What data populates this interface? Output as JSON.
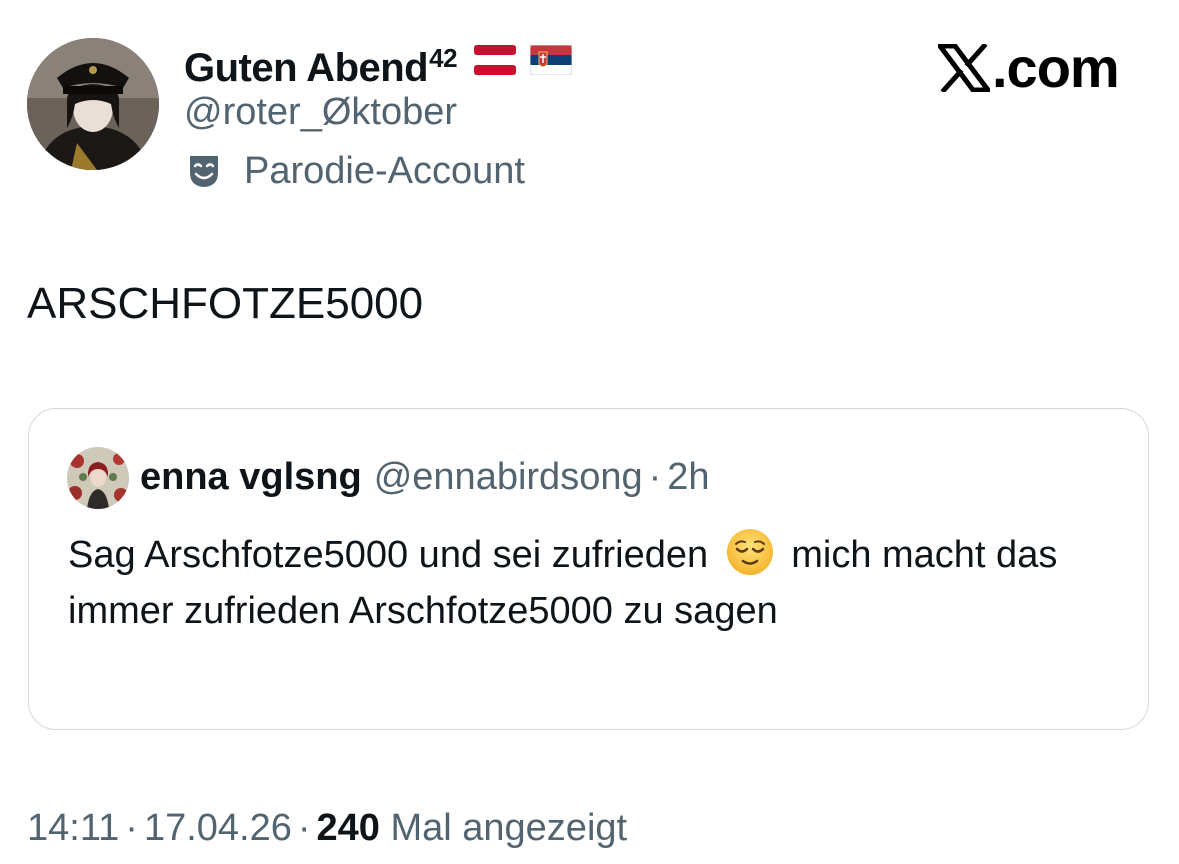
{
  "author": {
    "display_name": "Guten Abend",
    "superscript": "42",
    "flags": [
      "austria-flag",
      "serbia-flag"
    ],
    "handle": "@roter_Øktober",
    "label": "Parodie-Account",
    "label_icon": "theater-mask-icon"
  },
  "brand": {
    "logo_icon": "x-logo-icon",
    "suffix": ".com"
  },
  "tweet": {
    "text": "ARSCHFOTZE5000"
  },
  "quote": {
    "display_name": "enna vglsng",
    "handle": "@ennabirdsong",
    "separator": "·",
    "time": "2h",
    "text_part1": "Sag Arschfotze5000 und sei zufrieden",
    "emoji": "relieved-face-emoji",
    "text_part2": "mich macht das immer zufrieden Arschfotze5000 zu sagen"
  },
  "meta": {
    "time": "14:11",
    "separator": "·",
    "date": "17.04.26",
    "views_count": "240",
    "views_label": "Mal angezeigt"
  },
  "colors": {
    "text_primary": "#0f1419",
    "text_secondary": "#536471",
    "border": "#cfd9de",
    "austria_red": "#c8102e",
    "serbia_red": "#c6363c",
    "serbia_blue": "#0c4076"
  }
}
